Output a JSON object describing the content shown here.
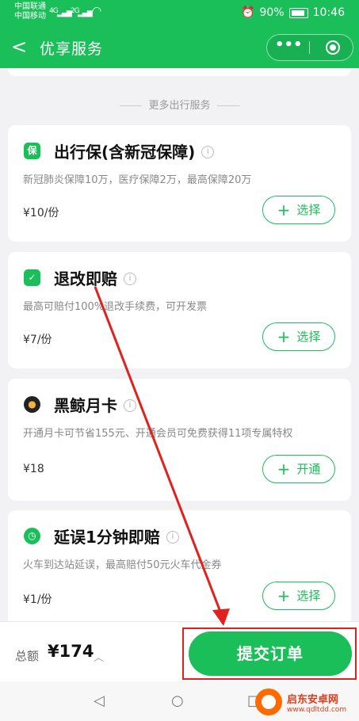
{
  "status_bar": {
    "carrier1": "中国联通",
    "carrier2": "中国移动",
    "net1": "4G",
    "net2": "2G",
    "battery": "90%",
    "time": "10:46"
  },
  "nav": {
    "back_glyph": "<",
    "title": "优享服务",
    "more_glyph": "•••"
  },
  "section_title": "更多出行服务",
  "cards": [
    {
      "icon_text": "保",
      "title": "出行保(含新冠保障)",
      "desc": "新冠肺炎保障10万，医疗保障2万，最高保障20万",
      "price": "¥10/份",
      "button": "选择"
    },
    {
      "icon_text": "✓",
      "title": "退改即赔",
      "desc": "最高可赔付100%退改手续费，可开发票",
      "price": "¥7/份",
      "button": "选择"
    },
    {
      "icon_text": "●",
      "title": "黑鲸月卡",
      "desc": "开通月卡可节省155元、开通会员可免费获得11项专属特权",
      "price": "¥18",
      "button": "开通"
    },
    {
      "icon_text": "◷",
      "title": "延误1分钟即赔",
      "desc": "火车到达站延误，最高赔付50元火车代金券",
      "price": "¥1/份",
      "button": "选择"
    }
  ],
  "bottom": {
    "total_label": "总额",
    "total_amount": "¥174",
    "caret": "︿",
    "submit": "提交订单"
  },
  "watermark": {
    "name": "启东安卓网",
    "url": "www.qdltdd.com"
  },
  "colors": {
    "brand_green": "#1bbf5a",
    "annotation_red": "#e0211e"
  }
}
